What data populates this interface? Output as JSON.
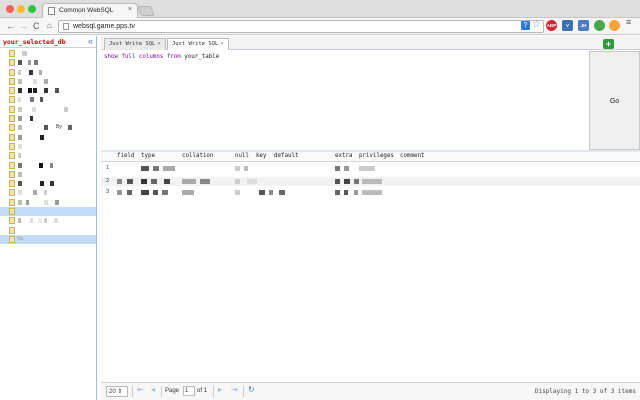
{
  "browser": {
    "tab_title": "Common WebSQL",
    "tab_close": "×",
    "url": "websql.game.pps.tv",
    "help_label": "?",
    "star_glyph": "☆",
    "extensions": [
      "ABP",
      "V",
      "JH",
      "",
      ""
    ]
  },
  "sidebar": {
    "db_name": "your_selected_db",
    "collapse_glyph": "«",
    "row_label_1": "By",
    "row_label_2": "Nu"
  },
  "tabs": [
    {
      "label": "Just Write SQL",
      "close": "×"
    },
    {
      "label": "Just Write SQL",
      "close": "×"
    }
  ],
  "add_tab_glyph": "+",
  "editor": {
    "kw1": "show full columns from",
    "table": "your_table"
  },
  "go_label": "Go",
  "grid": {
    "columns": [
      "field",
      "type",
      "collation",
      "null",
      "key",
      "default",
      "extra",
      "privileges",
      "comment"
    ],
    "rows": [
      "1",
      "2",
      "3"
    ]
  },
  "pager": {
    "page_size": "20 ⇕",
    "first": "⇤",
    "prev": "◂",
    "page_label": "Page",
    "page_value": "1",
    "of_label": "of 1",
    "next": "▸",
    "last": "⇥",
    "refresh": "↻",
    "status": "Displaying 1 to 3 of 3 items"
  },
  "colors": {
    "accent": "#3f78c8",
    "selection": "#c2dcf7",
    "db_name": "#cc0000"
  }
}
